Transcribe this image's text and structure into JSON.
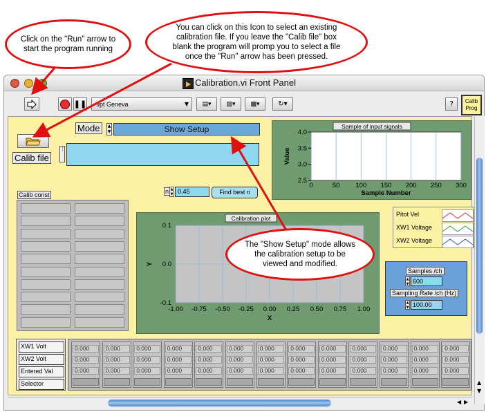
{
  "callouts": {
    "run": "Click on the \"Run\" arrow to start the program running",
    "calib": "You can click on this Icon to select an existing calibration file. If you leave the \"Calib file\" box blank the program will promp you to select a file once the \"Run\" arrow has been pressed.",
    "setup": "The \"Show Setup\" mode allows the calibration setup to be viewed and modified."
  },
  "window": {
    "title": "Calibration.vi Front Panel"
  },
  "toolbar": {
    "font": "9pt Geneva",
    "help": "?",
    "badge_line1": "Calib",
    "badge_line2": "Prog"
  },
  "controls": {
    "mode_label": "Mode",
    "mode_value": "Show Setup",
    "calib_file_label": "Calib file",
    "calib_file_value": "",
    "calib_const_label": "Calib const",
    "n_label": "n",
    "n_value": "0.45",
    "find_best_label": "Find best n",
    "samples_label": "Samples /ch",
    "samples_value": "600",
    "rate_label": "Sampling Rate /ch (Hz)",
    "rate_value": "100.00"
  },
  "legend": {
    "items": [
      {
        "label": "Pitot Vel",
        "color": "#e03030"
      },
      {
        "label": "XW1 Voltage",
        "color": "#30a030"
      },
      {
        "label": "XW2 Voltage",
        "color": "#3050d0"
      }
    ]
  },
  "array": {
    "row_labels": [
      "XW1 Volt",
      "XW2 Volt",
      "Entered Val",
      "Selector"
    ],
    "cell_value": "0.000"
  },
  "chart_data": [
    {
      "type": "line",
      "title": "Sample of input signals",
      "xlabel": "Sample Number",
      "ylabel": "Value",
      "xlim": [
        0,
        300
      ],
      "ylim": [
        2.5,
        4.0
      ],
      "x_ticks": [
        "0",
        "50",
        "100",
        "150",
        "200",
        "250",
        "300"
      ],
      "y_ticks": [
        "4.0",
        "3.5",
        "3.0",
        "2.5"
      ],
      "series": []
    },
    {
      "type": "scatter",
      "title": "Calibration plot",
      "xlabel": "X",
      "ylabel": "Y",
      "xlim": [
        -1.0,
        1.0
      ],
      "ylim": [
        -0.1,
        0.1
      ],
      "x_ticks": [
        "-1.00",
        "-0.75",
        "-0.50",
        "-0.25",
        "0.00",
        "0.25",
        "0.50",
        "0.75",
        "1.00"
      ],
      "y_ticks": [
        "0.1",
        "0.0",
        "-0.1"
      ],
      "series": []
    }
  ]
}
